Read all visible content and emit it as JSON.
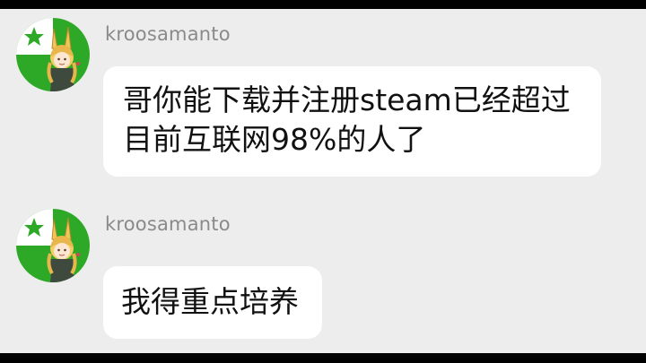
{
  "colors": {
    "background": "#ededed",
    "bubble": "#ffffff",
    "username_text": "#8a8a8a",
    "message_text": "#111111",
    "avatar_green": "#2ea827"
  },
  "messages": [
    {
      "username": "kroosamanto",
      "avatar_icon": "esperanto-flag-anime-girl-avatar",
      "lines": [
        "哥你能下载并注册steam已经超过",
        "目前互联网98%的人了"
      ]
    },
    {
      "username": "kroosamanto",
      "avatar_icon": "esperanto-flag-anime-girl-avatar",
      "lines": [
        "我得重点培养"
      ]
    }
  ]
}
